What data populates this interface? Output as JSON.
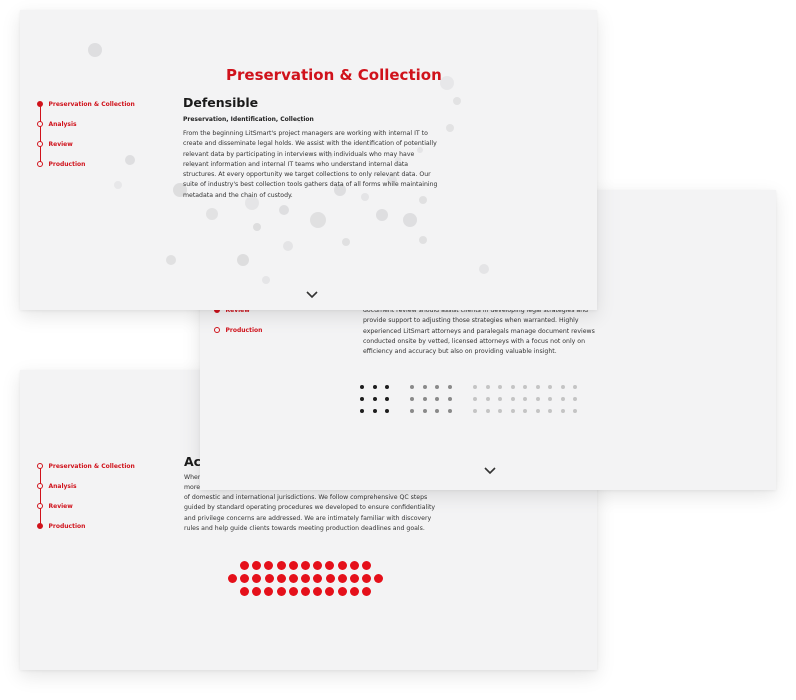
{
  "cards": {
    "preservation": {
      "heading": "Preservation & Collection",
      "subtitle": "Defensible",
      "subhead": "Preservation, Identification, Collection",
      "body": "From the beginning LitSmart's project managers are working with internal IT to create and disseminate legal holds. We assist with the identification of potentially relevant data by participating in interviews with individuals who may have relevant information and internal IT teams who understand internal data structures. At every opportunity we target collections to only relevant data. Our suite of industry's best collection tools gathers data of all forms while maintaining metadata and the chain of custody.",
      "timeline": [
        "Preservation & Collection",
        "Analysis",
        "Review",
        "Production"
      ],
      "active_index": 0
    },
    "review": {
      "body": "document review should assist clients in developing legal strategies and provide support to adjusting those strategies when warranted. Highly experienced LitSmart attorneys and paralegals manage document reviews conducted onsite by vetted, licensed attorneys with a focus not only on efficiency and accuracy but also on providing valuable insight.",
      "timeline": [
        "Review",
        "Production"
      ],
      "active_index": 0
    },
    "production": {
      "subtitle_partial": "Acc",
      "body_line1": "When",
      "body_line2": "more",
      "body": "of domestic and international jurisdictions. We follow comprehensive QC steps guided by standard operating procedures we developed to ensure confidentiality and privilege concerns are addressed. We are intimately familiar with discovery rules and help guide clients towards meeting production deadlines and goals.",
      "timeline": [
        "Preservation & Collection",
        "Analysis",
        "Review",
        "Production"
      ],
      "active_index": 3
    }
  },
  "colors": {
    "accent": "#d0121b",
    "dot_red": "#e5101a",
    "card_bg": "#f3f3f4"
  },
  "icons": {
    "scroll": "chevron-down-icon"
  }
}
